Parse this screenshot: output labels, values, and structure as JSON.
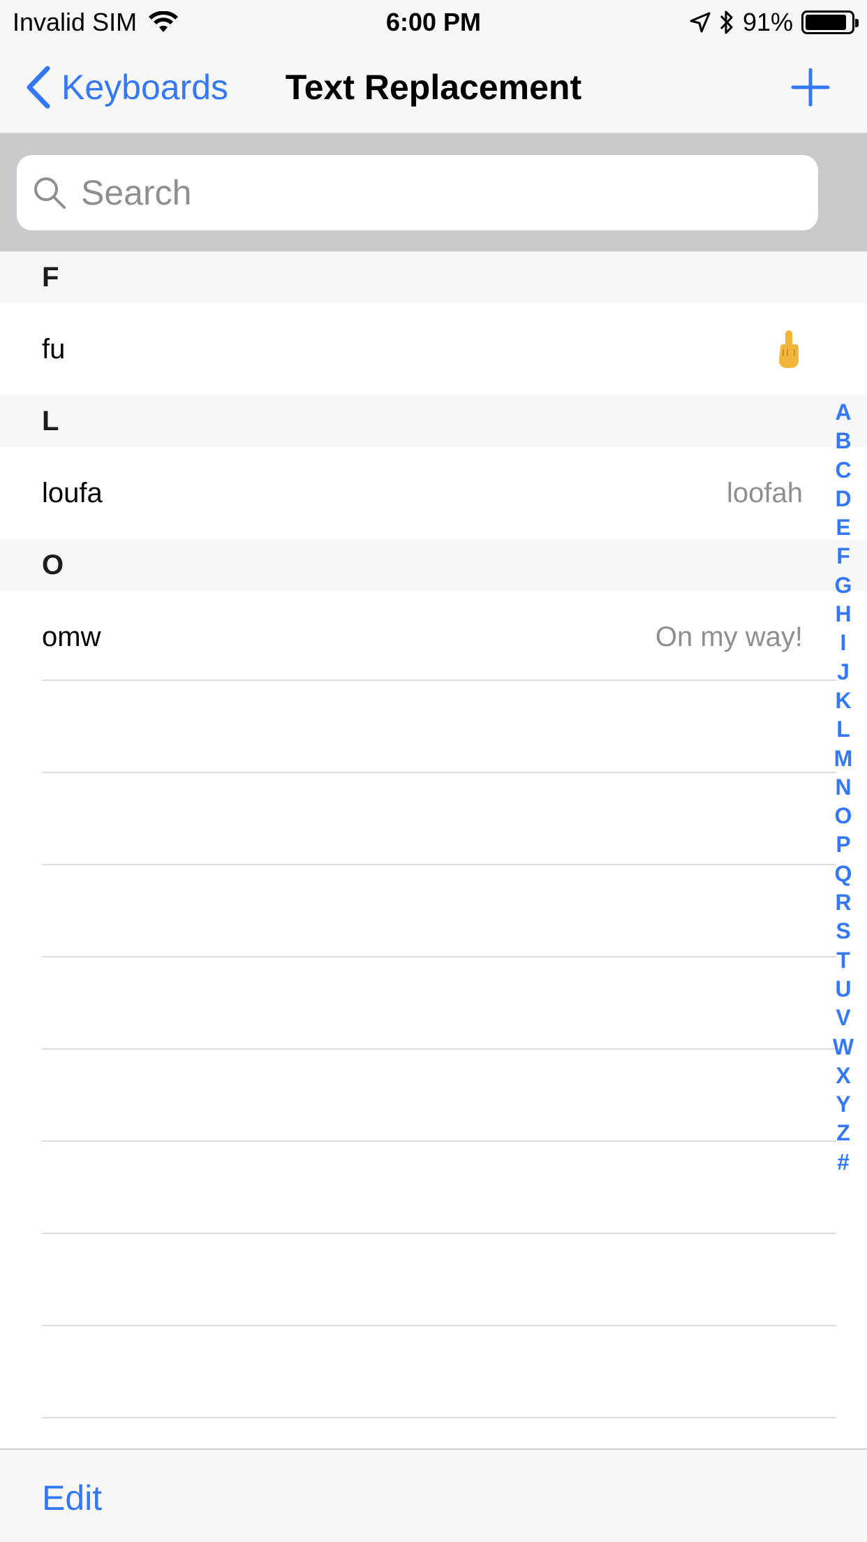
{
  "status_bar": {
    "carrier": "Invalid SIM",
    "time": "6:00 PM",
    "battery_percent": "91%",
    "battery_level": 0.91
  },
  "nav": {
    "back_label": "Keyboards",
    "title": "Text Replacement",
    "add_icon": "plus-icon"
  },
  "search": {
    "placeholder": "Search",
    "value": ""
  },
  "sections": [
    {
      "header": "F",
      "rows": [
        {
          "shortcut": "fu",
          "phrase_emoji": "middle-finger-emoji"
        }
      ]
    },
    {
      "header": "L",
      "rows": [
        {
          "shortcut": "loufa",
          "phrase": "loofah"
        }
      ]
    },
    {
      "header": "O",
      "rows": [
        {
          "shortcut": "omw",
          "phrase": "On my way!"
        }
      ]
    }
  ],
  "index": [
    "A",
    "B",
    "C",
    "D",
    "E",
    "F",
    "G",
    "H",
    "I",
    "J",
    "K",
    "L",
    "M",
    "N",
    "O",
    "P",
    "Q",
    "R",
    "S",
    "T",
    "U",
    "V",
    "W",
    "X",
    "Y",
    "Z",
    "#"
  ],
  "toolbar": {
    "edit_label": "Edit"
  },
  "colors": {
    "accent": "#3478f6",
    "secondary_text": "#8e8e93",
    "bar_bg": "#f7f7f7",
    "search_bg": "#c9c9ce"
  }
}
